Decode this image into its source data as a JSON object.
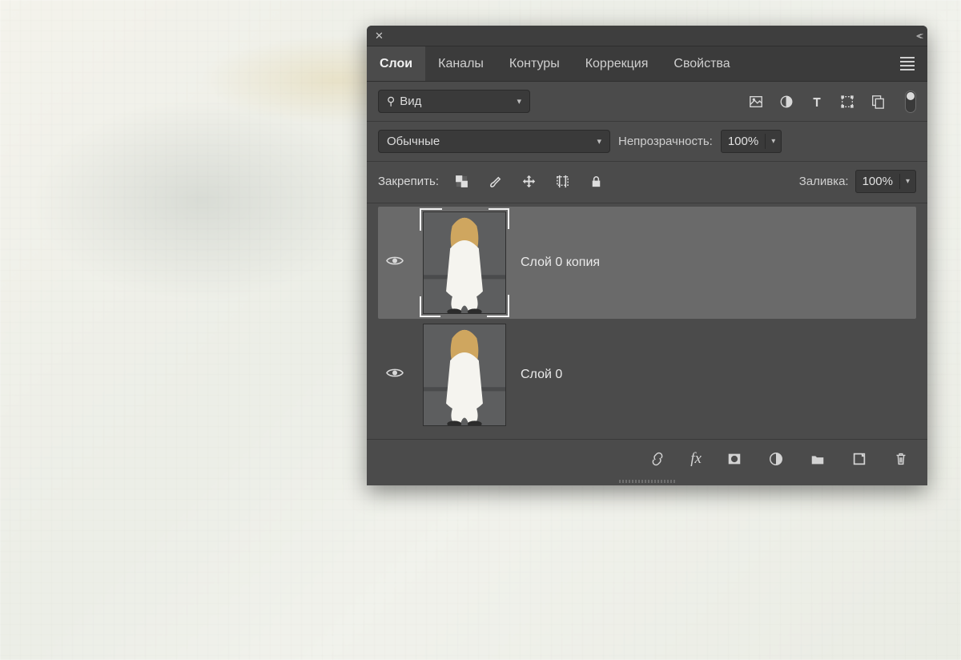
{
  "tabs": {
    "layers": "Слои",
    "channels": "Каналы",
    "paths": "Контуры",
    "adjust": "Коррекция",
    "props": "Свойства"
  },
  "search": {
    "label": "Вид"
  },
  "blend": {
    "mode": "Обычные"
  },
  "opacity": {
    "label": "Непрозрачность:",
    "value": "100%"
  },
  "lock": {
    "label": "Закрепить:"
  },
  "fill": {
    "label": "Заливка:",
    "value": "100%"
  },
  "layers_list": [
    {
      "name": "Слой 0 копия",
      "selected": true
    },
    {
      "name": "Слой 0",
      "selected": false
    }
  ],
  "icons": {
    "image": "image-icon",
    "adjust": "adjustment-icon",
    "text": "text-icon",
    "shape": "shape-icon",
    "smart": "smartobject-icon",
    "pixels": "lock-pixels-icon",
    "brush": "lock-brush-icon",
    "move": "lock-position-icon",
    "artbd": "lock-artboard-icon",
    "lock": "lock-all-icon",
    "link": "link-layers-icon",
    "fx": "layer-fx-icon",
    "mask": "layer-mask-icon",
    "adj2": "new-adjustment-icon",
    "group": "new-group-icon",
    "new": "new-layer-icon",
    "trash": "delete-layer-icon"
  },
  "footer_fx_label": "fx"
}
